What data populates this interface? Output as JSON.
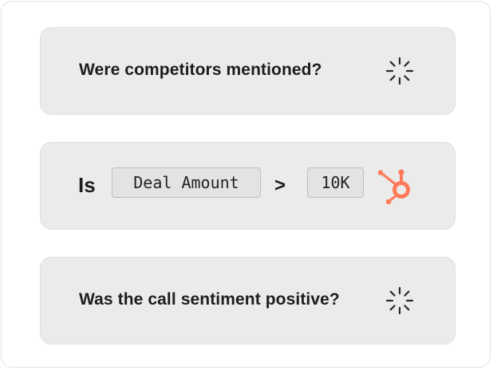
{
  "cards": [
    {
      "question": "Were competitors mentioned?",
      "status_icon": "loading-spinner-icon"
    },
    {
      "prefix": "Is",
      "field": "Deal Amount",
      "operator": ">",
      "value": "10K",
      "integration_icon": "hubspot-logo-icon",
      "accent_color": "#ff7a59"
    },
    {
      "question": "Was the call sentiment positive?",
      "status_icon": "loading-spinner-icon"
    }
  ]
}
